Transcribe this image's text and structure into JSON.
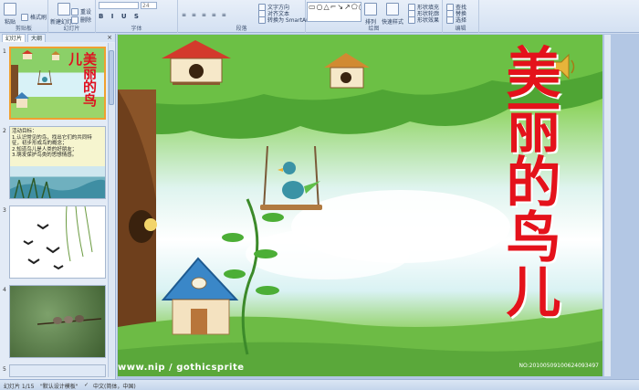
{
  "ribbon": {
    "groups": [
      {
        "label": "剪贴板",
        "buttons": [
          "粘贴",
          "格式刷"
        ]
      },
      {
        "label": "幻灯片",
        "buttons": [
          "新建幻灯片",
          "重设",
          "删除"
        ]
      },
      {
        "label": "字体",
        "font_size": "24"
      },
      {
        "label": "段落",
        "buttons": [
          "文字方向",
          "对齐文本",
          "转换为 SmartArt"
        ]
      },
      {
        "label": "绘图",
        "buttons": [
          "排列",
          "快速样式",
          "形状填充",
          "形状轮廓",
          "形状效果"
        ]
      },
      {
        "label": "编辑",
        "buttons": [
          "查找",
          "替换",
          "选择"
        ]
      }
    ]
  },
  "panel": {
    "tabs": [
      "幻灯片",
      "大纲"
    ],
    "close": "×",
    "slides": [
      {
        "num": "1",
        "title": "美丽的鸟儿"
      },
      {
        "num": "2",
        "text": "活动目标：\n1.认识常见的鸟，找出它们的共同特征，初步形成鸟的概念；\n2.知道鸟儿是人类的好朋友；\n3.萌发保护鸟类的思想情感。"
      },
      {
        "num": "3"
      },
      {
        "num": "4"
      },
      {
        "num": "5"
      }
    ]
  },
  "slide": {
    "title": "美丽的鸟儿",
    "watermark_left": "www.nip / gothicsprite",
    "watermark_right": "NO:20100509100624093497"
  },
  "status": {
    "slide_info": "幻灯片 1/15",
    "theme": "\"默认设计模板\"",
    "language": "中文(简体，中国)"
  },
  "colors": {
    "title_red": "#e4121b",
    "selection_orange": "#f0a030",
    "ribbon_blue": "#d4e1f2"
  }
}
